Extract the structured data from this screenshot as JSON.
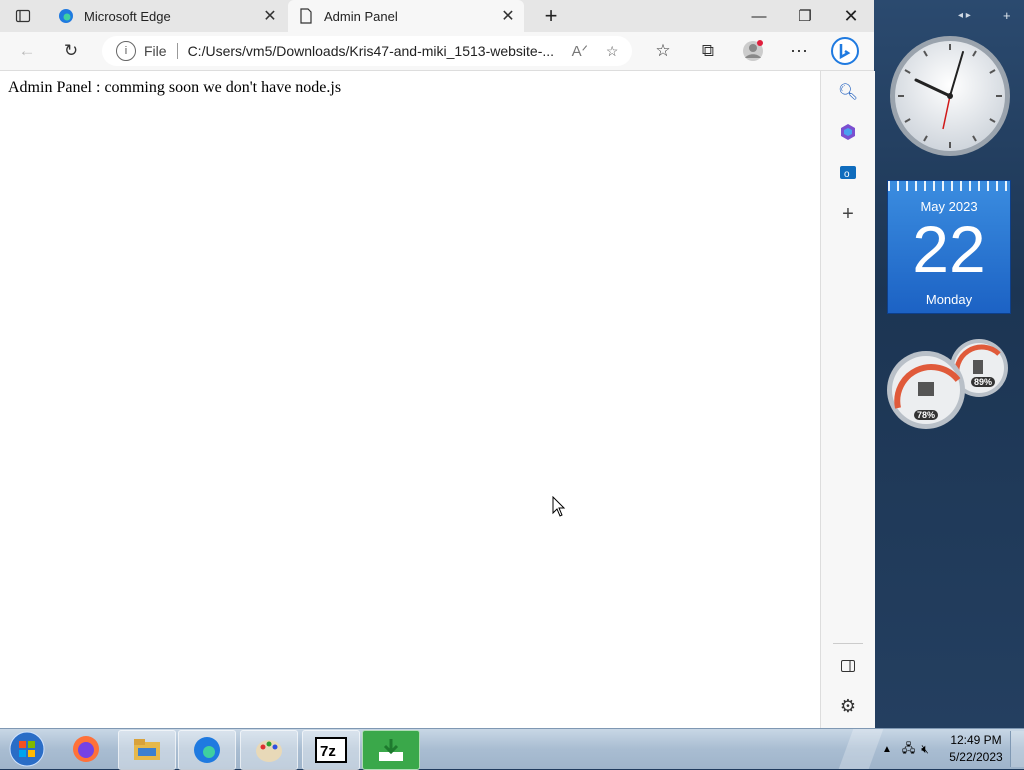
{
  "browser": {
    "tabs": [
      {
        "title": "Microsoft Edge",
        "icon": "edge-icon"
      },
      {
        "title": "Admin Panel",
        "icon": "page-icon"
      }
    ],
    "address": {
      "scheme_label": "File",
      "url": "C:/Users/vm5/Downloads/Kris47-and-miki_1513-website-..."
    },
    "content_text": "Admin Panel : comming soon we don't have node.js"
  },
  "gadgets": {
    "calendar": {
      "month": "May 2023",
      "day": "22",
      "weekday": "Monday"
    },
    "meters": {
      "cpu": "78%",
      "memory": "89%",
      "cpu_fraction": 0.78,
      "memory_fraction": 0.89
    }
  },
  "taskbar": {
    "time": "12:49 PM",
    "date": "5/22/2023",
    "items": [
      "start-orb",
      "firefox",
      "file-explorer",
      "edge",
      "paint",
      "7zip",
      "downloader"
    ]
  },
  "colors": {
    "accent": "#0c59c4",
    "edge_blue": "#1f7ae0"
  }
}
